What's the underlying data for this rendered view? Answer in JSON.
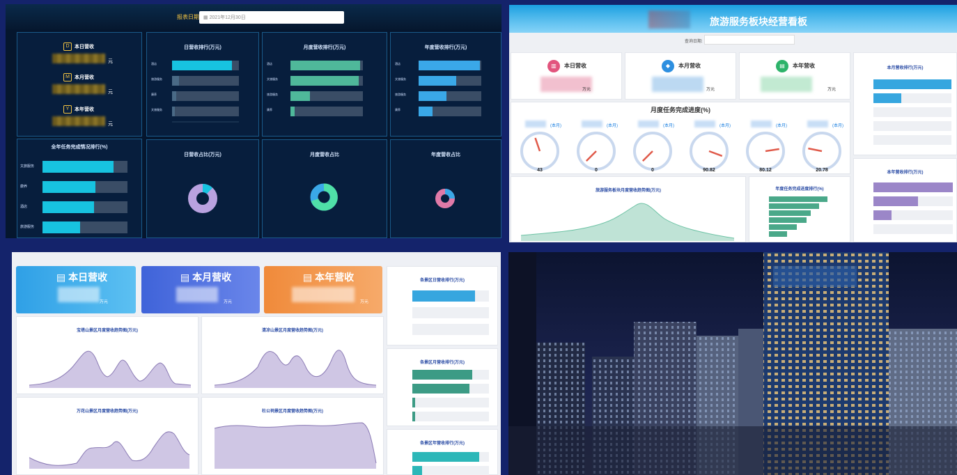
{
  "q1": {
    "query_label": "报表日期",
    "date_value": "2021年12月30日",
    "kpis": [
      {
        "icon": "D",
        "label": "本日营收",
        "unit": "元"
      },
      {
        "icon": "M",
        "label": "本月营收",
        "unit": "元"
      },
      {
        "icon": "Y",
        "label": "本年营收",
        "unit": "元"
      }
    ],
    "panel_titles": {
      "annual_task": "全年任务完成情况排行(%)",
      "daily_rank": "日营收排行(万元)",
      "monthly_rank": "月度营收排行(万元)",
      "yearly_rank": "年度营收排行(万元)",
      "daily_share": "日营收占比(万元)",
      "monthly_share": "月度营收占比",
      "yearly_share": "年度营收占比"
    },
    "annual_bar_labels": [
      "文旅服务",
      "康养",
      "酒店",
      "旅游服务"
    ],
    "rank_bar_labels": [
      "酒店",
      "旅游服务",
      "康养",
      "文旅服务"
    ],
    "rank_bar_labels_month": [
      "酒店",
      "文旅服务",
      "旅游服务",
      "康养"
    ],
    "rank_bar_labels_year": [
      "酒店",
      "文旅服务",
      "旅游服务",
      "康养"
    ],
    "colors": {
      "cyan": "#17c3e0",
      "green": "#4fb89a",
      "blue": "#3aa8e8",
      "purple": "#a78bd4"
    }
  },
  "q2": {
    "title": "旅游服务板块经营看板",
    "query_label": "查询日期:",
    "kpis": [
      {
        "label": "本日营收",
        "unit": "万元",
        "color": "#e2547d"
      },
      {
        "label": "本月营收",
        "unit": "万元",
        "color": "#2d8fe0"
      },
      {
        "label": "本年营收",
        "unit": "万元",
        "color": "#2db36a"
      }
    ],
    "progress_title": "月度任务完成进度(%)",
    "gauge_sub": "(本月)",
    "gauges": [
      43,
      0,
      0,
      90.82,
      80.12,
      20.78
    ],
    "trend_title": "旅游服务板块月度营收趋势图(万元)",
    "annual_progress_title": "年度任务完成进度排行(%)",
    "right_titles": [
      "本月营收排行(万元)",
      "本年营收排行(万元)"
    ]
  },
  "q3": {
    "cards": [
      {
        "label": "本日营收",
        "unit": "万元",
        "color": "#2fa0e6"
      },
      {
        "label": "本月营收",
        "unit": "万元",
        "color": "#3f63d9"
      },
      {
        "label": "本年营收",
        "unit": "万元",
        "color": "#f08a3a"
      }
    ],
    "chart_titles": [
      "宝塔山景区月度营收趋势图(万元)",
      "清凉山景区月度营收趋势图(万元)",
      "万花山景区月度营收趋势图(万元)",
      "杜公祠景区月度营收趋势图(万元)"
    ],
    "right_titles": [
      "各景区日营收排行(万元)",
      "各景区月营收排行(万元)",
      "各景区年营收排行(万元)"
    ]
  }
}
